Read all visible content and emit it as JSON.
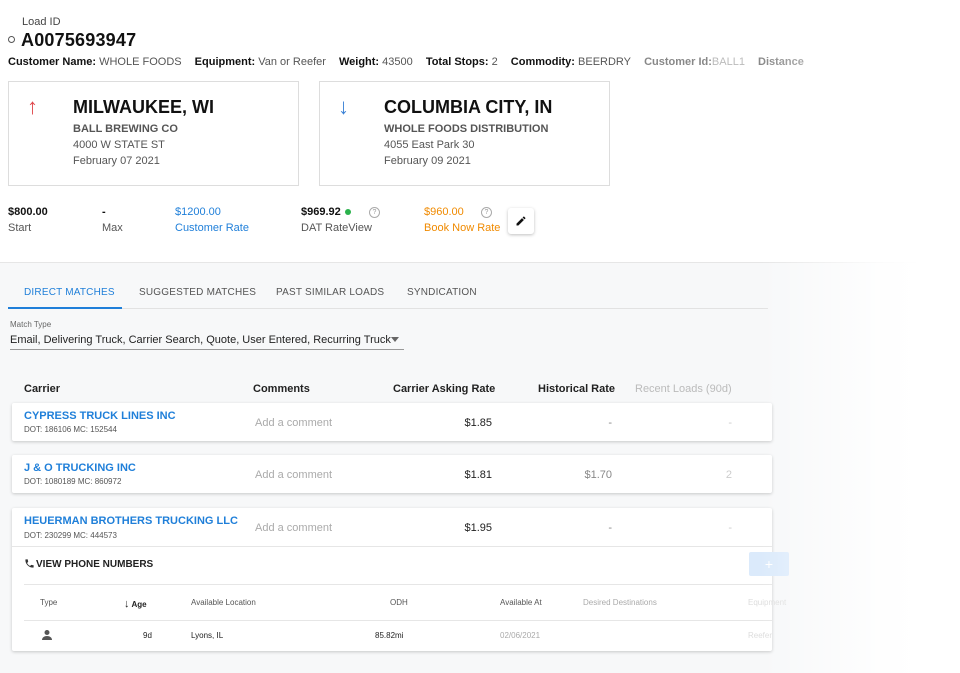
{
  "load": {
    "label": "Load ID",
    "id": "A0075693947"
  },
  "meta": [
    {
      "key": "Customer Name:",
      "value": "WHOLE FOODS"
    },
    {
      "key": "Equipment:",
      "value": "Van or Reefer"
    },
    {
      "key": "Weight:",
      "value": "43500"
    },
    {
      "key": "Total Stops:",
      "value": "2"
    },
    {
      "key": "Commodity:",
      "value": "BEERDRY"
    },
    {
      "key": "Customer Id:",
      "value": "BALL1"
    },
    {
      "key": "Distance",
      "value": ""
    }
  ],
  "origin": {
    "city": "MILWAUKEE, WI",
    "company": "BALL BREWING CO",
    "address": "4000 W STATE ST",
    "date": "February 07 2021"
  },
  "destination": {
    "city": "COLUMBIA CITY, IN",
    "company": "WHOLE FOODS DISTRIBUTION",
    "address": "4055 East Park 30",
    "date": "February 09 2021"
  },
  "rates": {
    "start": {
      "value": "$800.00",
      "label": "Start"
    },
    "max": {
      "value": "-",
      "label": "Max"
    },
    "customer": {
      "value": "$1200.00",
      "label": "Customer Rate"
    },
    "dat": {
      "value": "$969.92",
      "label": "DAT RateView"
    },
    "book_now": {
      "value": "$960.00",
      "label": "Book Now Rate"
    },
    "help_glyph": "?"
  },
  "colors": {
    "accent": "#1f7fd9",
    "pickup": "#e0474c",
    "orange": "#f08a00",
    "green": "#2bb24c"
  },
  "tabs": [
    "DIRECT MATCHES",
    "SUGGESTED MATCHES",
    "PAST SIMILAR LOADS",
    "SYNDICATION"
  ],
  "match_type": {
    "label": "Match Type",
    "value": "Email, Delivering Truck, Carrier Search, Quote, User Entered, Recurring Truck"
  },
  "table": {
    "headers": [
      "Carrier",
      "Comments",
      "Carrier Asking Rate",
      "Historical Rate",
      "Recent Loads (90d)"
    ],
    "comment_placeholder": "Add a comment",
    "rows": [
      {
        "name": "CYPRESS TRUCK LINES INC",
        "ids": "DOT: 186106 MC: 152544",
        "ask": "$1.85",
        "hist": "-",
        "recent": "-"
      },
      {
        "name": "J & O TRUCKING INC",
        "ids": "DOT: 1080189 MC: 860972",
        "ask": "$1.81",
        "hist": "$1.70",
        "recent": "2"
      },
      {
        "name": "HEUERMAN BROTHERS TRUCKING LLC",
        "ids": "DOT: 230299 MC: 444573",
        "ask": "$1.95",
        "hist": "-",
        "recent": "-"
      }
    ]
  },
  "expanded": {
    "phone_label": "VIEW PHONE NUMBERS",
    "add_glyph": "+",
    "sub_headers": [
      "Type",
      "Age",
      "Available Location",
      "ODH",
      "Available At",
      "Desired Destinations",
      "Equipment"
    ],
    "sub_row": {
      "type_icon": "person-icon",
      "age": "9d",
      "location": "Lyons, IL",
      "odh": "85.82mi",
      "available_at": "02/06/2021",
      "desired": "",
      "equipment": "Reefer"
    }
  }
}
